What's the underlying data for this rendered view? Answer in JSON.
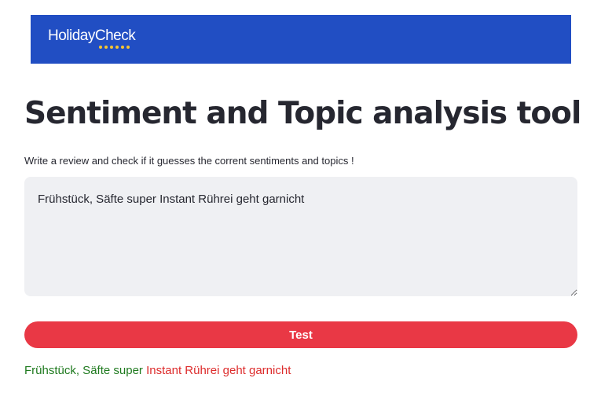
{
  "header": {
    "logo_text": "HolidayCheck"
  },
  "main": {
    "title": "Sentiment and Topic analysis tool",
    "instructions": "Write a review and check if it guesses the corrent sentiments and topics !",
    "review_value": "Frühstück, Säfte super Instant Rührei geht garnicht",
    "test_button_label": "Test",
    "result": {
      "positive_segment": "Frühstück, Säfte super",
      "negative_segment": "Instant Rührei geht garnicht"
    }
  },
  "colors": {
    "banner": "#214ec3",
    "button": "#e93845",
    "positive": "#1f7a1f",
    "negative": "#dd2c2c"
  }
}
